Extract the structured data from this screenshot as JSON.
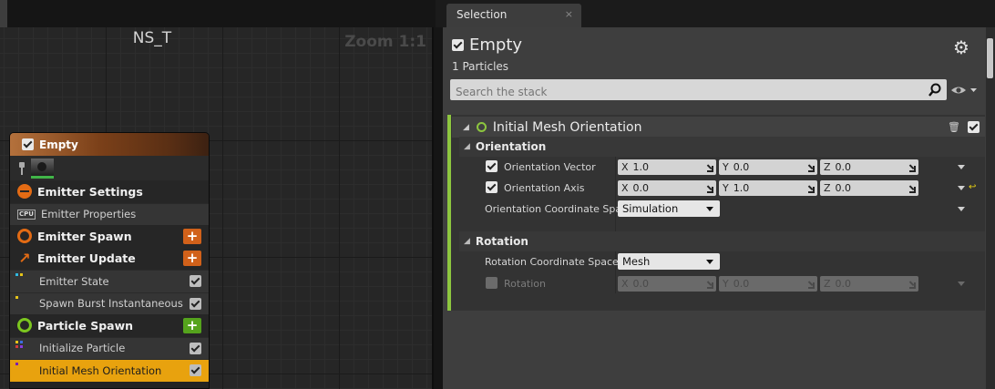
{
  "graph": {
    "title": "NS_T",
    "zoom": "Zoom 1:1"
  },
  "node": {
    "title": "Empty",
    "rows": [
      {
        "label": "Emitter Settings"
      },
      {
        "label": "Emitter Properties"
      },
      {
        "label": "Emitter Spawn",
        "add": "+"
      },
      {
        "label": "Emitter Update",
        "add": "+"
      },
      {
        "label": "Emitter State"
      },
      {
        "label": "Spawn Burst Instantaneous"
      },
      {
        "label": "Particle Spawn",
        "add": "+"
      },
      {
        "label": "Initialize Particle"
      },
      {
        "label": "Initial Mesh Orientation"
      }
    ],
    "cpu_label": "CPU",
    "colors": {
      "orange": "#e36b14",
      "green": "#7cc61f",
      "selected": "#e8a20e"
    }
  },
  "selection": {
    "tab_label": "Selection",
    "tab_close": "×",
    "emitter_name": "Empty",
    "particles": "1 Particles",
    "search_placeholder": "Search the stack",
    "module": {
      "name": "Initial Mesh Orientation",
      "accent": "#8dc63f",
      "sections": [
        {
          "name": "Orientation",
          "rows": [
            {
              "label": "Orientation Vector",
              "x": "1.0",
              "y": "0.0",
              "z": "0.0"
            },
            {
              "label": "Orientation Axis",
              "x": "0.0",
              "y": "1.0",
              "z": "0.0"
            },
            {
              "label": "Orientation Coordinate Spac",
              "value": "Simulation"
            }
          ]
        },
        {
          "name": "Rotation",
          "rows": [
            {
              "label": "Rotation Coordinate Space",
              "value": "Mesh"
            },
            {
              "label": "Rotation",
              "x": "0.0",
              "y": "0.0",
              "z": "0.0"
            }
          ]
        }
      ]
    },
    "axis_labels": {
      "x": "X",
      "y": "Y",
      "z": "Z"
    },
    "icons": [
      "gear-icon",
      "search-icon",
      "eye-icon",
      "trash-icon",
      "reset-arrow-icon"
    ]
  }
}
